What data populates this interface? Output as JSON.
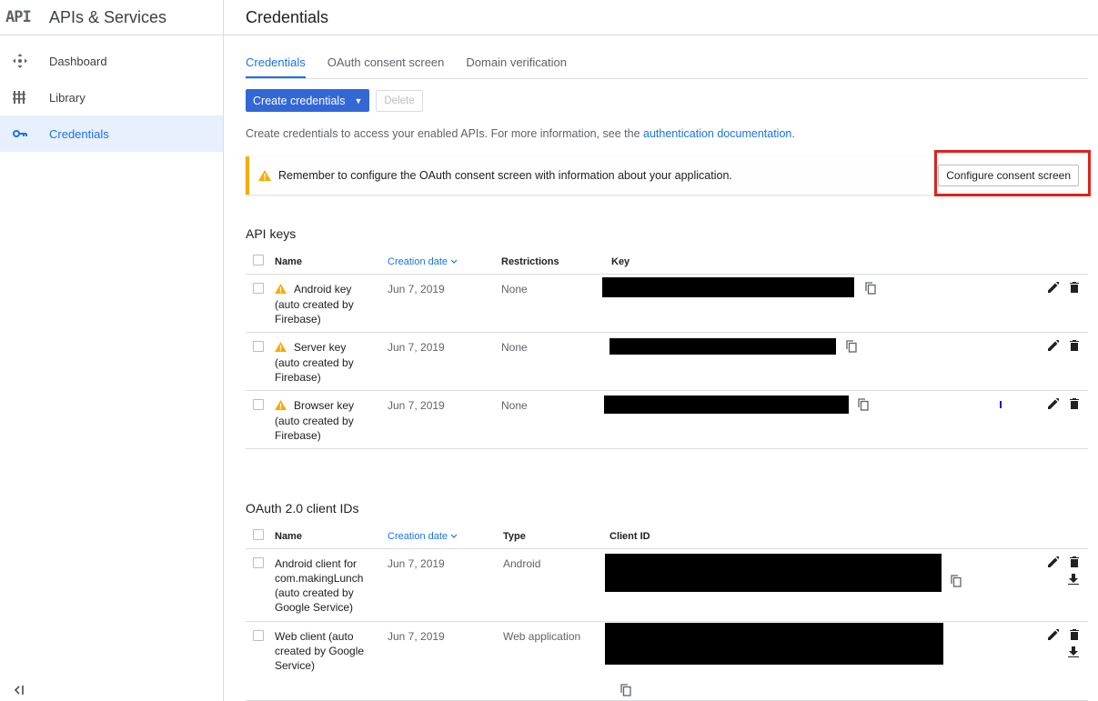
{
  "sidebar": {
    "logo": "API",
    "title": "APIs & Services",
    "items": [
      {
        "label": "Dashboard",
        "icon": "dashboard-icon",
        "active": false
      },
      {
        "label": "Library",
        "icon": "library-icon",
        "active": false
      },
      {
        "label": "Credentials",
        "icon": "key-icon",
        "active": true
      }
    ],
    "collapse_label": "<|"
  },
  "header": {
    "title": "Credentials"
  },
  "tabs": [
    {
      "label": "Credentials",
      "active": true
    },
    {
      "label": "OAuth consent screen",
      "active": false
    },
    {
      "label": "Domain verification",
      "active": false
    }
  ],
  "toolbar": {
    "create_label": "Create credentials",
    "delete_label": "Delete"
  },
  "intro": {
    "text": "Create credentials to access your enabled APIs. For more information, see the ",
    "link": "authentication documentation",
    "suffix": "."
  },
  "warning": {
    "text": "Remember to configure the OAuth consent screen with information about your application.",
    "button": "Configure consent screen"
  },
  "api_keys": {
    "title": "API keys",
    "columns": {
      "name": "Name",
      "date": "Creation date",
      "restrictions": "Restrictions",
      "key": "Key"
    },
    "rows": [
      {
        "name_l1": "Android key",
        "name_l2": "(auto created by",
        "name_l3": "Firebase)",
        "date": "Jun 7, 2019",
        "restrictions": "None"
      },
      {
        "name_l1": "Server key",
        "name_l2": "(auto created by",
        "name_l3": "Firebase)",
        "date": "Jun 7, 2019",
        "restrictions": "None"
      },
      {
        "name_l1": "Browser key",
        "name_l2": "(auto created by",
        "name_l3": "Firebase)",
        "date": "Jun 7, 2019",
        "restrictions": "None"
      }
    ]
  },
  "oauth": {
    "title": "OAuth 2.0 client IDs",
    "columns": {
      "name": "Name",
      "date": "Creation date",
      "type": "Type",
      "client_id": "Client ID"
    },
    "rows": [
      {
        "name_l1": "Android client for",
        "name_l2": "com.makingLunch",
        "name_l3": "(auto created by",
        "name_l4": "Google Service)",
        "date": "Jun 7, 2019",
        "type": "Android"
      },
      {
        "name_l1": "Web client (auto",
        "name_l2": "created by Google",
        "name_l3": "Service)",
        "date": "Jun 7, 2019",
        "type": "Web application"
      }
    ]
  },
  "colors": {
    "accent": "#1a73e8",
    "primary_button": "#3367d6",
    "warning": "#f9ab00",
    "highlight": "#e2211c"
  }
}
